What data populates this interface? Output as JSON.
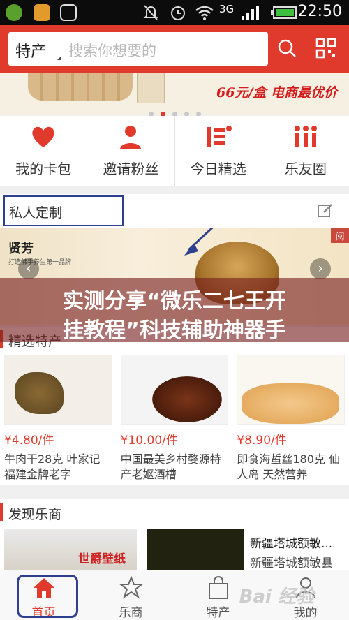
{
  "status_bar": {
    "time": "22:50",
    "network": "3G",
    "icons": [
      "app-icon-green",
      "chat-icon",
      "image-icon",
      "mute-icon",
      "alarm-icon",
      "wifi-icon",
      "signal-icon",
      "battery-icon"
    ]
  },
  "header": {
    "category": "特产",
    "search_placeholder": "搜索你想要的",
    "icons": [
      "search-icon",
      "qr-code-icon"
    ],
    "accent": "#e03a2c"
  },
  "banner": {
    "price_text": "66元/盒 电商最优价",
    "dots": 5,
    "active_dot": 1
  },
  "quick_nav": [
    {
      "label": "我的卡包",
      "icon": "heart-icon"
    },
    {
      "label": "邀请粉丝",
      "icon": "person-icon"
    },
    {
      "label": "今日精选",
      "icon": "list-icon"
    },
    {
      "label": "乐友圈",
      "icon": "group-icon"
    }
  ],
  "custom_section": {
    "title": "私人定制",
    "hero_brand": "贤芳",
    "hero_sub": "打造佛手养生第一品牌",
    "hero_tag": "阅"
  },
  "overlay_caption": {
    "line1": "实测分享“微乐二七王开",
    "line2": "挂教程”科技辅助神器手"
  },
  "featured": {
    "title": "精选特产",
    "products": [
      {
        "price": "¥4.80/件",
        "name": "牛肉干28克 叶家记 福建金牌老字"
      },
      {
        "price": "¥10.00/件",
        "name": "中国最美乡村婺源特产老妪酒槽"
      },
      {
        "price": "¥8.90/件",
        "name": "即食海蜇丝180克 仙人岛 天然营养"
      }
    ]
  },
  "discover": {
    "title": "发现乐商",
    "img1_text": "世爵壁纸",
    "item_title_1": "新疆塔城额敏...",
    "item_title_2": "新疆塔城额敏县"
  },
  "bottom_nav": [
    {
      "label": "首页",
      "icon": "home-icon",
      "active": true
    },
    {
      "label": "乐商",
      "icon": "shop-icon",
      "active": false
    },
    {
      "label": "特产",
      "icon": "bag-icon",
      "active": false
    },
    {
      "label": "我的",
      "icon": "user-icon",
      "active": false
    }
  ],
  "watermark": "Bai 经验"
}
